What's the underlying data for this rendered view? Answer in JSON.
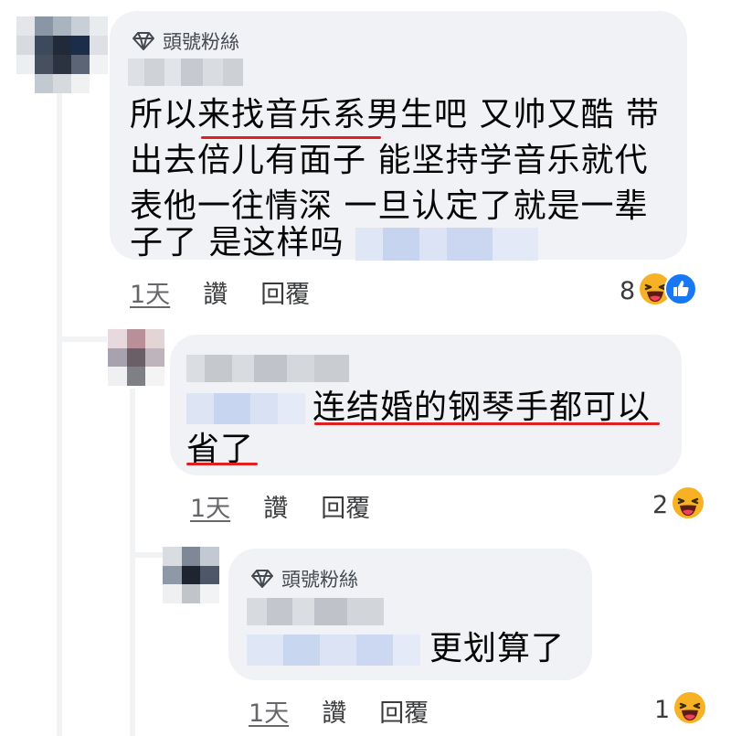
{
  "comments": [
    {
      "badge": "頭號粉絲",
      "lines": [
        "所以来找音乐系男生吧 又帅又酷 带",
        "出去倍儿有面子 能坚持学音乐就代",
        "表他一往情深 一旦认定了就是一辈",
        "子了 是这样吗"
      ],
      "time": "1天",
      "like": "讚",
      "reply": "回覆",
      "reactions": "8"
    },
    {
      "lines": [
        "连结婚的钢琴手都可以",
        "省了"
      ],
      "time": "1天",
      "like": "讚",
      "reply": "回覆",
      "reactions": "2"
    },
    {
      "badge": "頭號粉絲",
      "lines": [
        "更划算了"
      ],
      "time": "1天",
      "like": "讚",
      "reply": "回覆",
      "reactions": "1"
    }
  ],
  "colors": {
    "underline": "#e02020",
    "bubble": "#f0f2f5",
    "like_blue": "#1877f2",
    "haha_yellow": "#f7b125"
  },
  "icons": [
    "diamond-icon",
    "haha-reaction-icon",
    "like-reaction-icon"
  ]
}
